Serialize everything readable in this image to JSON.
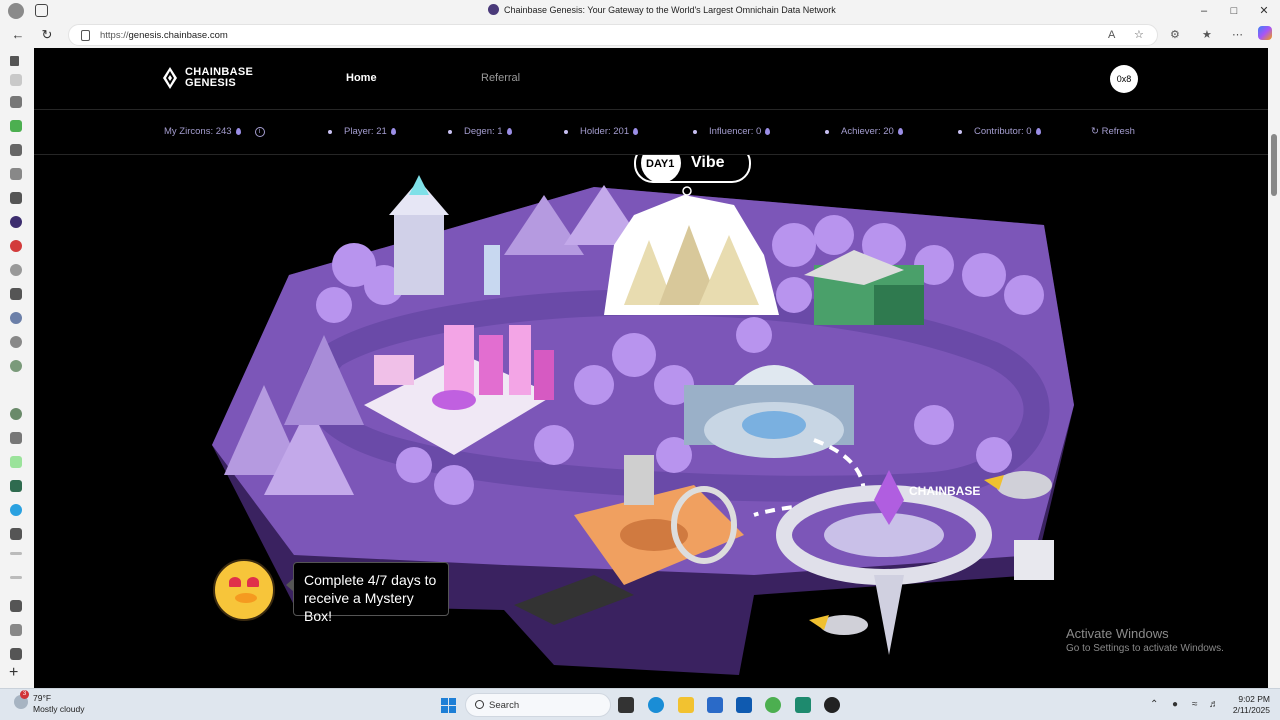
{
  "browser": {
    "window_title": "Chainbase Genesis: Your Gateway to the World's Largest Omnichain Data Network",
    "url_prefix": "https://",
    "url_host": "genesis.chainbase.com"
  },
  "site": {
    "logo_line1": "CHAINBASE",
    "logo_line2": "GENESIS",
    "nav": {
      "home": "Home",
      "referral": "Referral"
    },
    "wallet_label": "0x8"
  },
  "stats": {
    "zircons": "My Zircons: 243",
    "player": "Player: 21",
    "degen": "Degen: 1",
    "holder": "Holder: 201",
    "influencer": "Influencer: 0",
    "achiever": "Achiever: 20",
    "contributor": "Contributor: 0",
    "refresh": "Refresh"
  },
  "scene": {
    "daily_banner": "DAY1  Vibe",
    "mystery_line1": "Complete 4/7 days to",
    "mystery_line2": "receive a Mystery Box!",
    "sign_text": "CHAINBASE"
  },
  "windows": {
    "activate_title": "Activate Windows",
    "activate_sub": "Go to Settings to activate Windows."
  },
  "taskbar": {
    "weather_temp": "79°F",
    "weather_desc": "Mostly cloudy",
    "weather_badge": "3",
    "search_label": "Search",
    "time": "9:02 PM",
    "date": "2/11/2025"
  },
  "colors": {
    "accent": "#a49dcf",
    "island": "#7c56b8",
    "road": "#6a4aa8",
    "page_bg": "#000000"
  }
}
